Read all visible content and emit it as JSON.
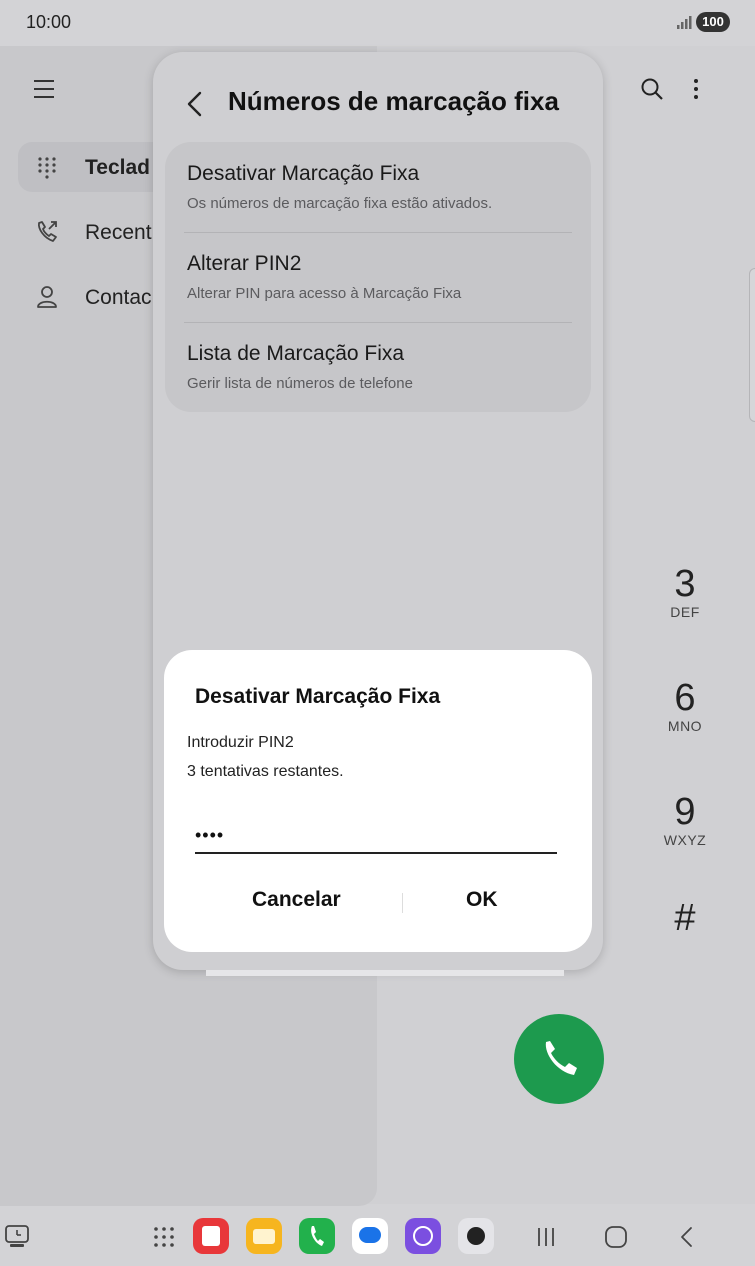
{
  "status_bar": {
    "time": "10:00",
    "battery": "100"
  },
  "phone_app": {
    "nav": [
      {
        "label": "Teclad",
        "icon": "dialpad-icon",
        "active": true
      },
      {
        "label": "Recent",
        "icon": "recents-icon",
        "active": false
      },
      {
        "label": "Contac",
        "icon": "contacts-icon",
        "active": false
      }
    ],
    "keypad": [
      {
        "digit": "3",
        "letters": "DEF"
      },
      {
        "digit": "6",
        "letters": "MNO"
      },
      {
        "digit": "9",
        "letters": "WXYZ"
      },
      {
        "digit": "#",
        "letters": ""
      }
    ]
  },
  "popup": {
    "title": "Números de marcação fixa",
    "settings": [
      {
        "title": "Desativar Marcação Fixa",
        "subtitle": "Os números de marcação fixa estão ativados."
      },
      {
        "title": "Alterar PIN2",
        "subtitle": "Alterar PIN para acesso à Marcação Fixa"
      },
      {
        "title": "Lista de Marcação Fixa",
        "subtitle": "Gerir lista de números de telefone"
      }
    ]
  },
  "dialog": {
    "title": "Desativar Marcação Fixa",
    "message_line1": "Introduzir PIN2",
    "message_line2": "3 tentativas restantes.",
    "pin_value": "••••",
    "cancel_label": "Cancelar",
    "ok_label": "OK"
  },
  "colors": {
    "call_green": "#1d9a4e",
    "dialog_bg": "#ffffff",
    "popup_bg": "#cfcfd2"
  }
}
